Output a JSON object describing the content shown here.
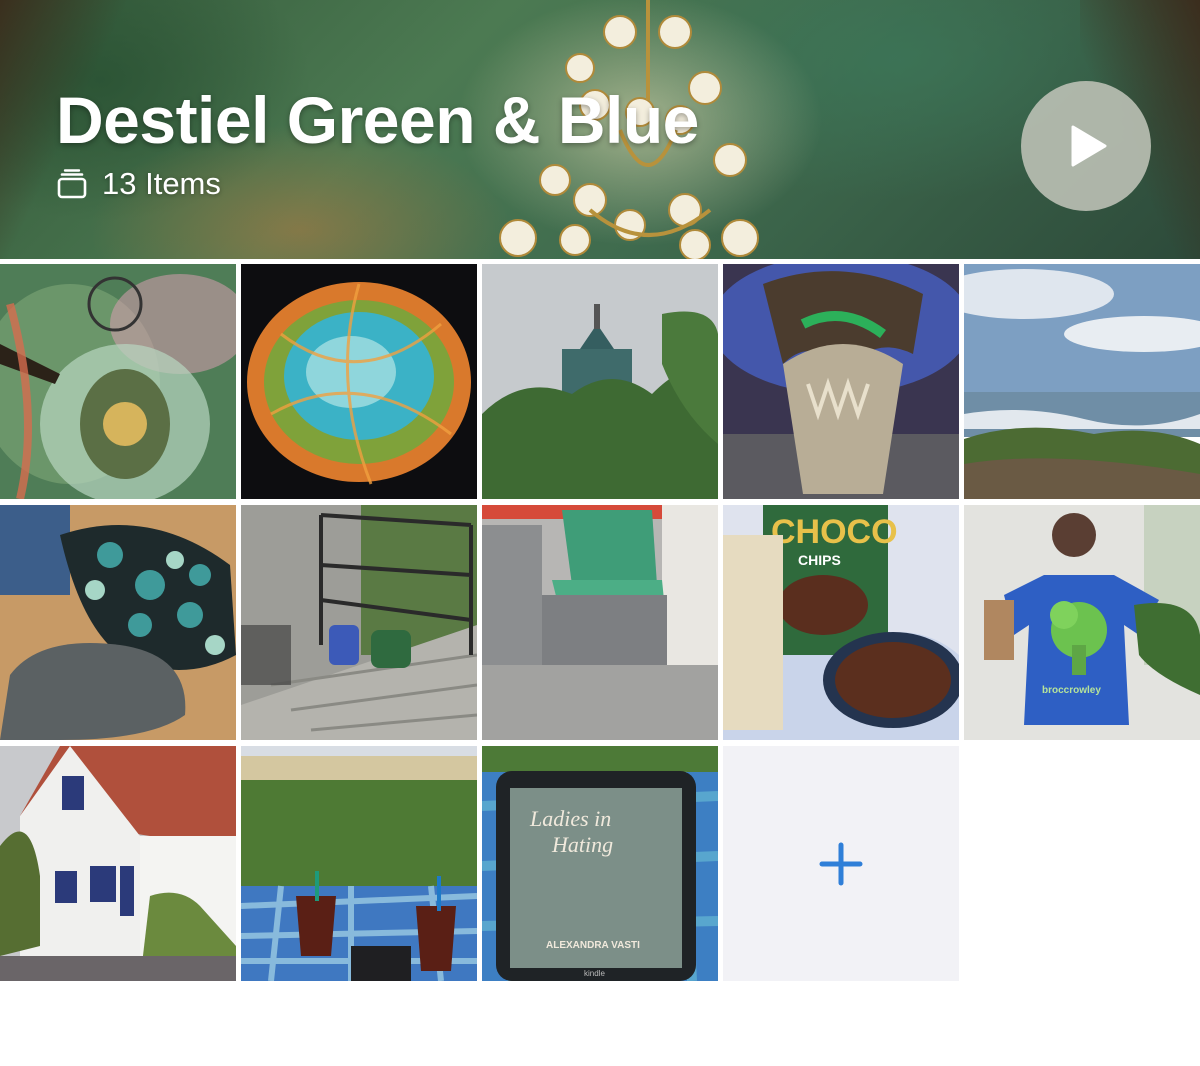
{
  "album": {
    "title": "Destiel Green & Blue",
    "item_count_label": "13 Items"
  },
  "icons": {
    "stack": "stack-icon",
    "play": "play-icon",
    "add": "plus-icon"
  },
  "colors": {
    "accent": "#2f7fd8",
    "add_tile_bg": "#f2f2f6",
    "play_bg": "#b9beb2"
  },
  "photos": [
    {
      "subject": "mosaic ceiling"
    },
    {
      "subject": "crab nebula"
    },
    {
      "subject": "tower above trees"
    },
    {
      "subject": "dinosaur skeleton"
    },
    {
      "subject": "rocky seashore"
    },
    {
      "subject": "patterned bucket hat"
    },
    {
      "subject": "watering cans on steps"
    },
    {
      "subject": "tram seat"
    },
    {
      "subject": "choco chips cereal"
    },
    {
      "subject": "mirror selfie broccoli shirt"
    },
    {
      "subject": "white house blue shutters"
    },
    {
      "subject": "picnic iced drinks"
    },
    {
      "subject": "kindle reader on blanket"
    }
  ],
  "photo_texts": {
    "cereal_box": "CHOCO",
    "cereal_sub": "CHIPS",
    "shirt_text": "broccrowley",
    "book_title_1": "Ladies in",
    "book_title_2": "Hating",
    "book_author": "ALEXANDRA VASTI",
    "device_brand": "kindle"
  }
}
